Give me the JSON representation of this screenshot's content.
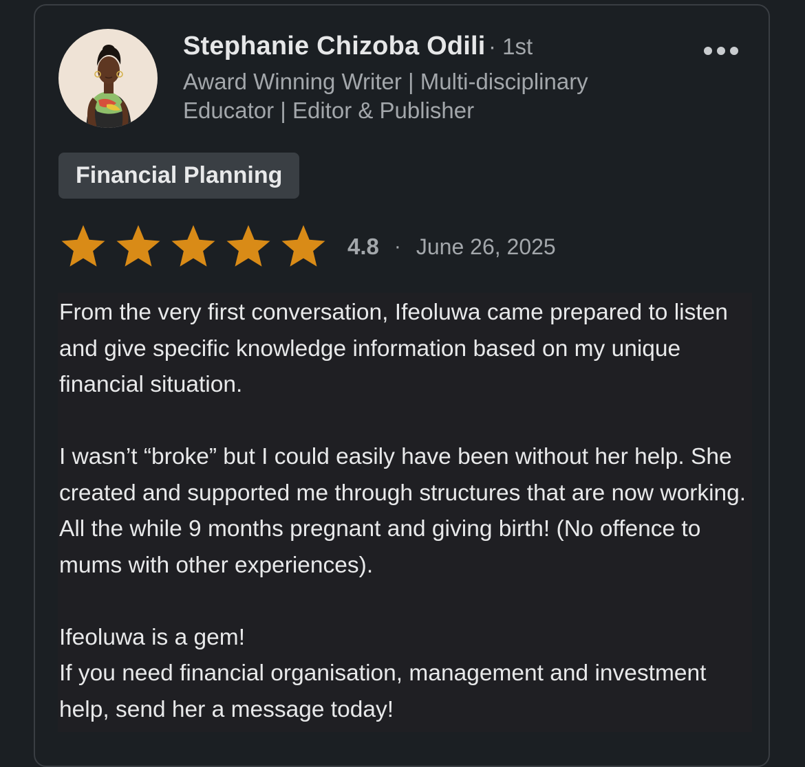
{
  "reviewer": {
    "name": "Stephanie Chizoba Odili",
    "degree": "· 1st",
    "headline": "Award Winning Writer | Multi-disciplinary Educator | Editor & Publisher"
  },
  "more_icon": "more-horizontal-icon",
  "tag": "Financial Planning",
  "rating": {
    "value": "4.8",
    "stars": 5,
    "star_color": "#d98b17",
    "separator": "·",
    "date": "June 26, 2025"
  },
  "review": {
    "paragraph_1": "From the very first conversation, Ifeoluwa came prepared to listen and give specific knowledge information based on my unique financial situation.",
    "paragraph_2": "I wasn’t “broke” but I could easily have been without her help. She created and supported me through structures that are now working. All the while 9 months pregnant and giving birth! (No offence to mums with other experiences).",
    "paragraph_3_line_1": "Ifeoluwa is a gem!",
    "paragraph_3_line_2": "If you need financial organisation, management and investment help, send her a message today!"
  },
  "colors": {
    "background": "#1b1f23",
    "card_border": "#3a3e43",
    "tag_background": "#3a3f44",
    "primary_text": "#e8e9ea",
    "secondary_text": "#a3a7ab"
  }
}
